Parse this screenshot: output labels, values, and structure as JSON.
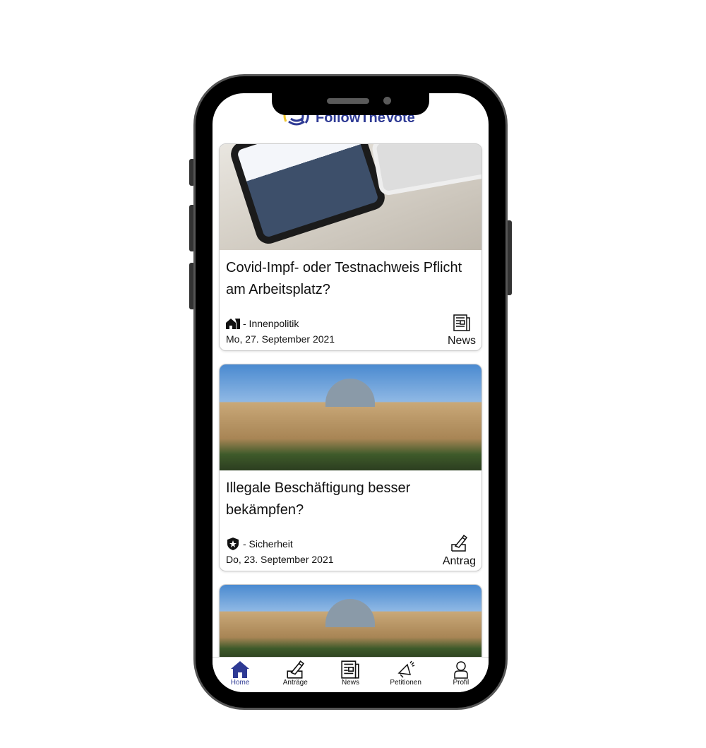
{
  "app": {
    "name": "FollowTheVote",
    "accent": "#2e3a94"
  },
  "cards": [
    {
      "title": "Covid-Impf- oder Testnachweis Pflicht am Arbeitsplatz?",
      "category": "- Innenpolitik",
      "category_icon": "house-icon",
      "date": "Mo, 27. September 2021",
      "type": "News",
      "type_icon": "newspaper-icon"
    },
    {
      "title": "Illegale Beschäftigung besser bekämpfen?",
      "category": "- Sicherheit",
      "category_icon": "shield-star-icon",
      "date": "Do, 23. September 2021",
      "type": "Antrag",
      "type_icon": "ballot-icon"
    }
  ],
  "nav": [
    {
      "label": "Home"
    },
    {
      "label": "Anträge"
    },
    {
      "label": "News"
    },
    {
      "label": "Petitionen"
    },
    {
      "label": "Profil"
    }
  ]
}
